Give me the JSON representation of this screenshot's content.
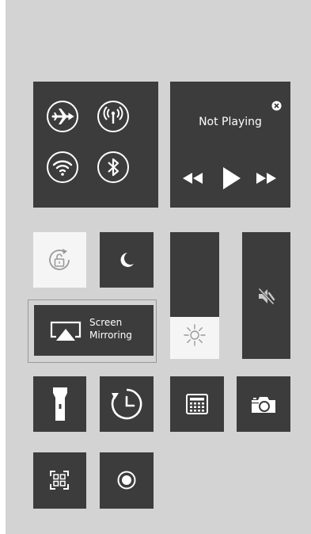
{
  "colors": {
    "panel_bg": "#d3d3d3",
    "tile_dark": "#3c3c3c",
    "tile_light": "#f5f5f5",
    "icon_white": "#ffffff"
  },
  "connectivity": {
    "airplane_icon": "airplane-icon",
    "cellular_icon": "antenna-icon",
    "wifi_icon": "wifi-icon",
    "bluetooth_icon": "bluetooth-icon"
  },
  "media": {
    "status": "Not Playing",
    "close_icon": "close-circle-icon",
    "controls": [
      "rewind-icon",
      "play-icon",
      "fast-forward-icon"
    ]
  },
  "toggles": {
    "rotation_lock_icon": "rotation-lock-icon",
    "do_not_disturb_icon": "moon-icon"
  },
  "brightness": {
    "level": 0.33,
    "icon": "sun-icon"
  },
  "volume": {
    "level": 0,
    "icon": "mute-speaker-icon"
  },
  "screen_mirroring": {
    "label_line1": "Screen",
    "label_line2": "Mirroring",
    "icon": "airplay-icon"
  },
  "shortcuts": [
    "flashlight-icon",
    "timer-icon",
    "calculator-icon",
    "camera-icon",
    "qr-scanner-icon",
    "screen-record-icon"
  ]
}
